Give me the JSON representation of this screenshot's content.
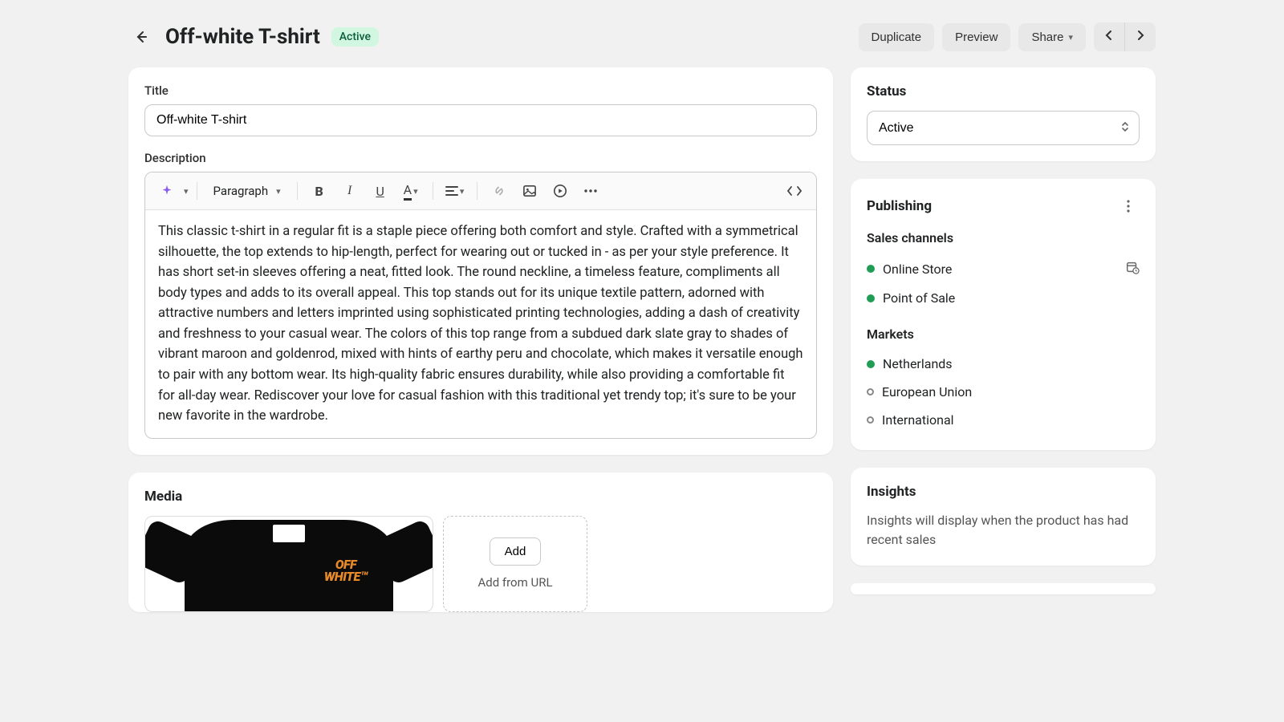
{
  "header": {
    "title": "Off-white T-shirt",
    "status_badge": "Active",
    "duplicate": "Duplicate",
    "preview": "Preview",
    "share": "Share"
  },
  "title_section": {
    "label": "Title",
    "value": "Off-white T-shirt"
  },
  "description_section": {
    "label": "Description",
    "format_selector": "Paragraph",
    "body": "This classic t-shirt in a regular fit is a staple piece offering both comfort and style. Crafted with a symmetrical silhouette, the top extends to hip-length, perfect for wearing out or tucked in - as per your style preference. It has short set-in sleeves offering a neat, fitted look. The round neckline, a timeless feature, compliments all body types and adds to its overall appeal. This top stands out for its unique textile pattern, adorned with attractive numbers and letters imprinted using sophisticated printing technologies, adding a dash of creativity and freshness to your casual wear. The colors of this top range from a subdued dark slate gray to shades of vibrant maroon and goldenrod, mixed with hints of earthy peru and chocolate, which makes it versatile enough to pair with any bottom wear. Its high-quality fabric ensures durability, while also providing a comfortable fit for all-day wear. Rediscover your love for casual fashion with this traditional yet trendy top; it's sure to be your new favorite in the wardrobe."
  },
  "media_section": {
    "label": "Media",
    "add_label": "Add",
    "url_label": "Add from URL",
    "product_logo_line1": "OFF",
    "product_logo_line2": "WHITE™"
  },
  "status_card": {
    "label": "Status",
    "value": "Active"
  },
  "publishing": {
    "label": "Publishing",
    "sales_label": "Sales channels",
    "channels": [
      {
        "name": "Online Store",
        "active": true,
        "schedule_icon": true
      },
      {
        "name": "Point of Sale",
        "active": true
      }
    ],
    "markets_label": "Markets",
    "markets": [
      {
        "name": "Netherlands",
        "active": true
      },
      {
        "name": "European Union",
        "active": false
      },
      {
        "name": "International",
        "active": false
      }
    ]
  },
  "insights": {
    "label": "Insights",
    "text": "Insights will display when the product has had recent sales"
  }
}
